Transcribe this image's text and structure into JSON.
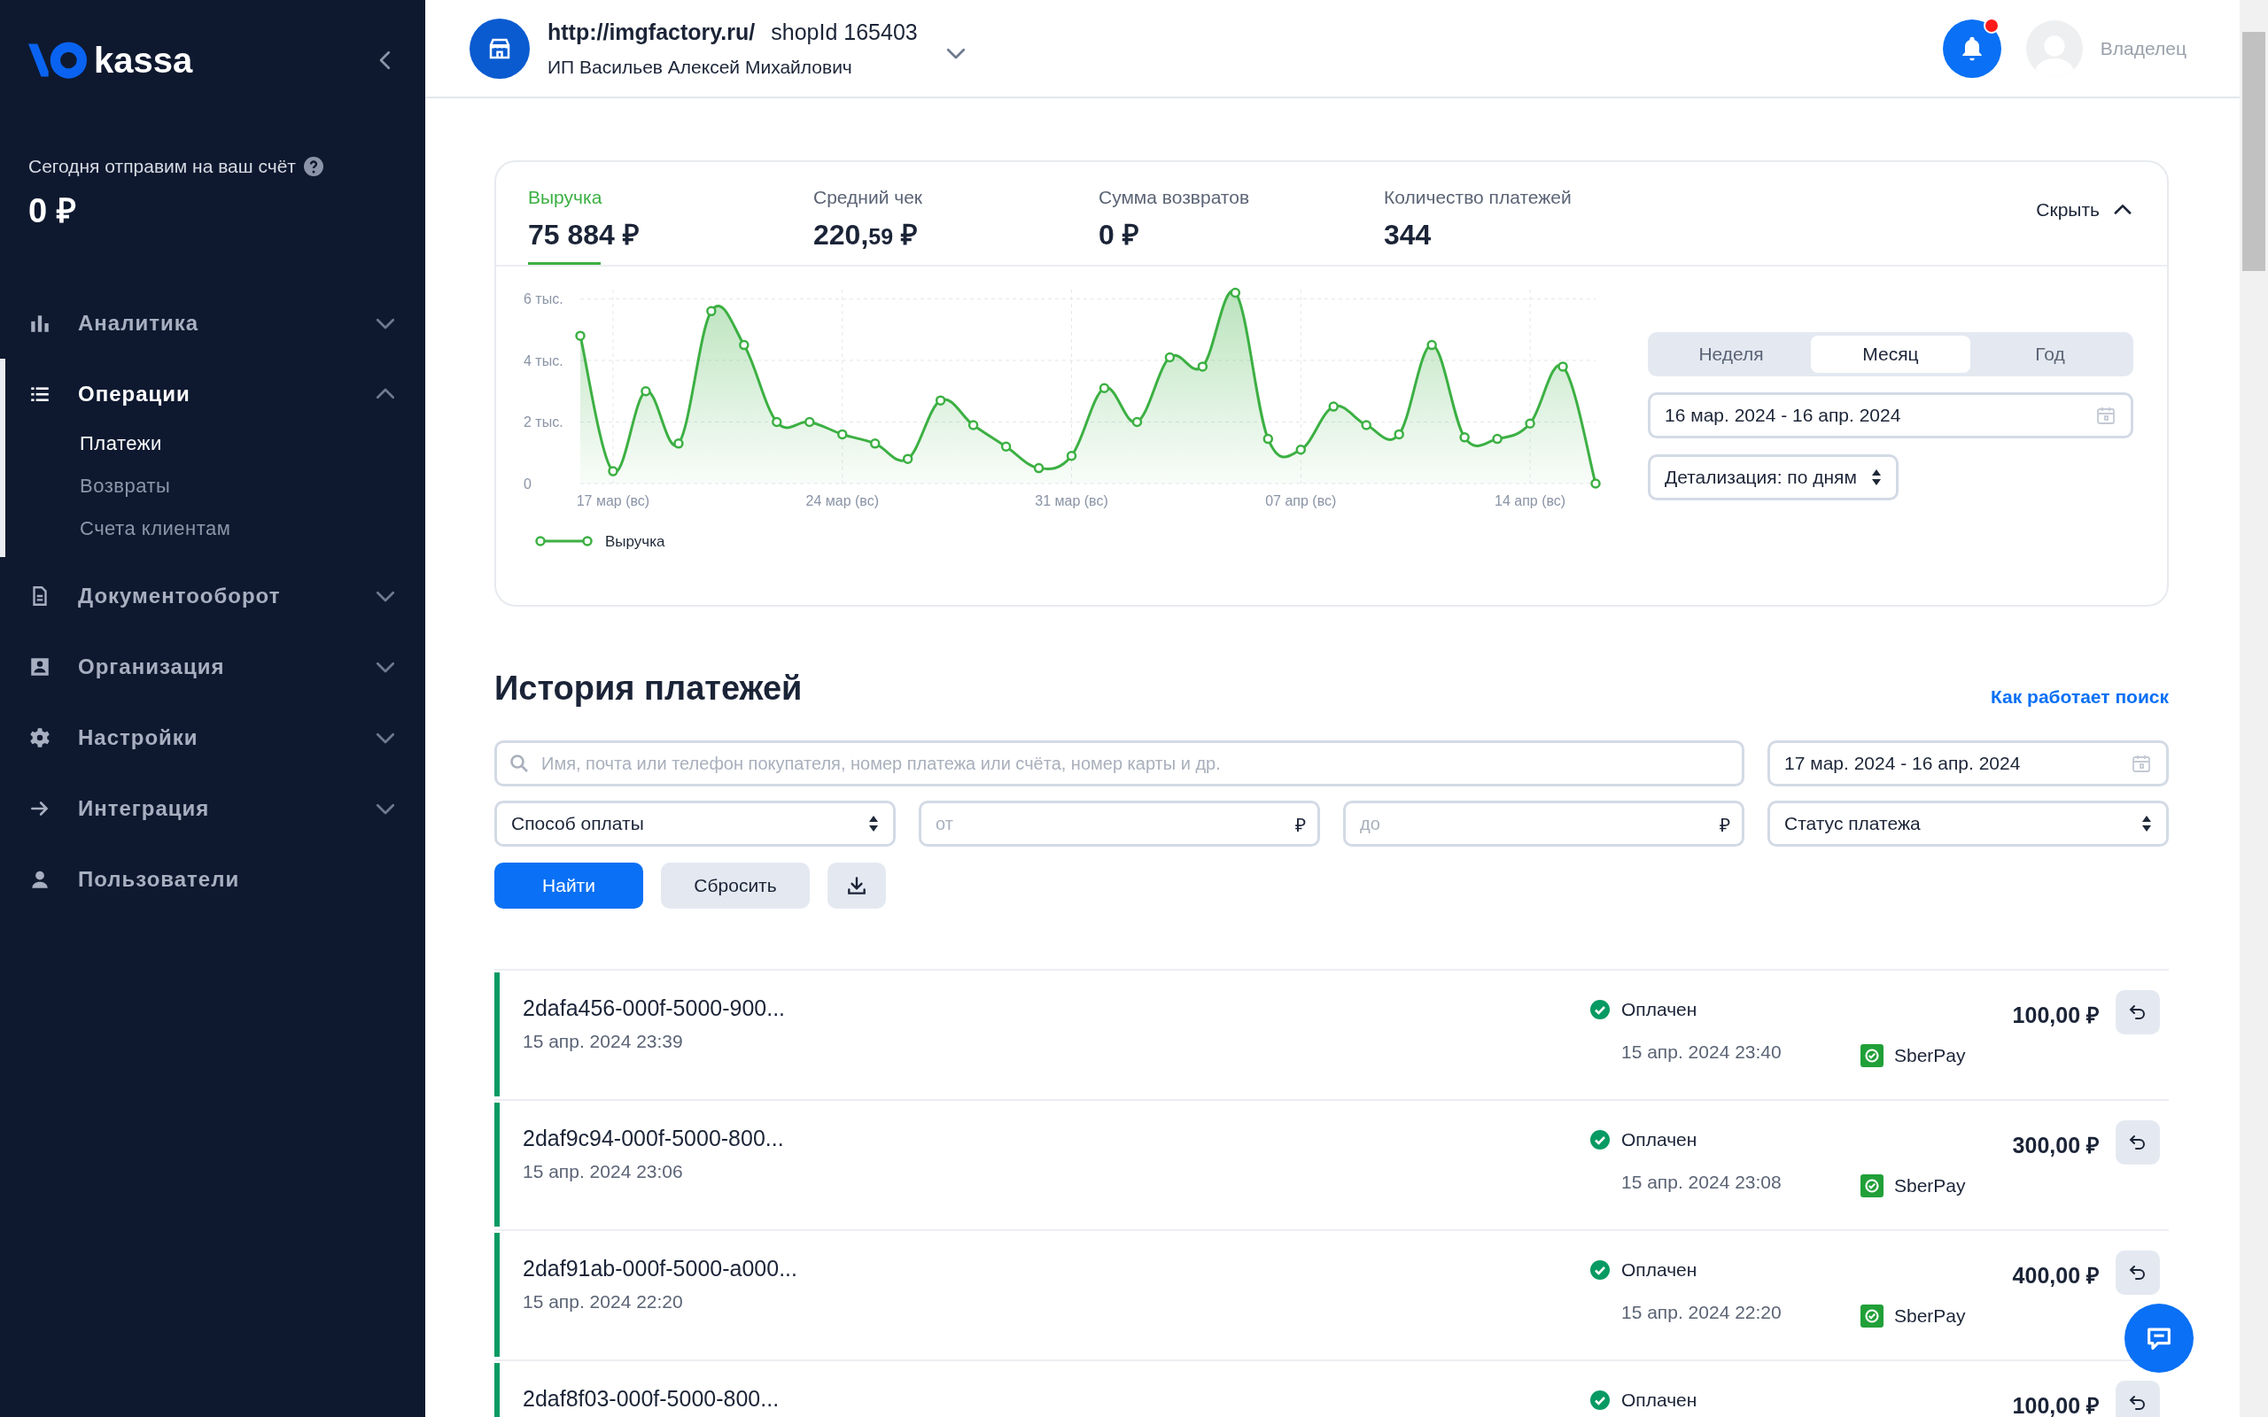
{
  "sidebar": {
    "logo_text": "kassa",
    "balance_label": "Сегодня отправим на ваш счёт",
    "balance_value": "0 ₽",
    "nav": [
      {
        "label": "Аналитика",
        "expanded": false,
        "selected": false
      },
      {
        "label": "Операции",
        "expanded": true,
        "selected": true,
        "children": [
          {
            "label": "Платежи",
            "selected": true
          },
          {
            "label": "Возвраты",
            "selected": false
          },
          {
            "label": "Счета клиентам",
            "selected": false
          }
        ]
      },
      {
        "label": "Документооборот",
        "expanded": false,
        "selected": false
      },
      {
        "label": "Организация",
        "expanded": false,
        "selected": false
      },
      {
        "label": "Настройки",
        "expanded": false,
        "selected": false
      },
      {
        "label": "Интеграция",
        "expanded": false,
        "selected": false
      },
      {
        "label": "Пользователи",
        "selected": false
      }
    ]
  },
  "header": {
    "shop_url": "http://imgfactory.ru/",
    "shop_id": "shopId 165403",
    "shop_owner": "ИП Васильев Алексей Михайлович",
    "notifications_unread": true,
    "user_role": "Владелец"
  },
  "stats": {
    "metrics": [
      {
        "label": "Выручка",
        "value": "75 884 ₽",
        "selected": true
      },
      {
        "label": "Средний чек",
        "value": "220,",
        "value_fraction": "59",
        "value_currency": " ₽",
        "selected": false
      },
      {
        "label": "Сумма возвратов",
        "value": "0 ₽",
        "selected": false
      },
      {
        "label": "Количество платежей",
        "value": "344",
        "selected": false
      }
    ],
    "hide_toggle": "Скрыть",
    "chart_data": {
      "type": "area",
      "grid": true,
      "categories": [
        null,
        "17 мар (вс)",
        null,
        null,
        null,
        null,
        null,
        null,
        "24 мар (вс)",
        null,
        null,
        null,
        null,
        null,
        null,
        "31 мар (вс)",
        null,
        null,
        null,
        null,
        null,
        null,
        "07 апр (вс)",
        null,
        null,
        null,
        null,
        null,
        null,
        "14 апр (вс)",
        null,
        null
      ],
      "series": [
        {
          "name": "Выручка",
          "color": "#3cb043",
          "marker": true,
          "values": [
            4.8,
            0.4,
            3.0,
            1.3,
            5.6,
            4.5,
            2.0,
            2.0,
            1.6,
            1.3,
            0.8,
            2.7,
            1.9,
            1.2,
            0.5,
            0.9,
            3.1,
            2.0,
            4.1,
            3.8,
            6.2,
            1.45,
            1.1,
            2.5,
            1.9,
            1.6,
            4.5,
            1.5,
            1.45,
            1.95,
            3.8,
            0
          ]
        }
      ],
      "ylim": [
        0,
        6.3
      ],
      "yticks": [
        {
          "value": 0,
          "label": "0"
        },
        {
          "value": 2,
          "label": "2 тыс."
        },
        {
          "value": 4,
          "label": "4 тыс."
        },
        {
          "value": 6,
          "label": "6 тыс."
        }
      ]
    },
    "periods": [
      {
        "label": "Неделя",
        "selected": false
      },
      {
        "label": "Месяц",
        "selected": true
      },
      {
        "label": "Год",
        "selected": false
      }
    ],
    "date_range": "16 мар. 2024 - 16 апр. 2024",
    "detail_select": "Детализация: по дням"
  },
  "history": {
    "title": "История платежей",
    "help_link": "Как работает поиск",
    "search_placeholder": "Имя, почта или телефон покупателя, номер платежа или счёта, номер карты и др.",
    "date_range": "17 мар. 2024 - 16 апр. 2024",
    "method_select": "Способ оплаты",
    "amount_from_placeholder": "от",
    "amount_to_placeholder": "до",
    "currency_sign": "₽",
    "status_select": "Статус платежа",
    "find_button": "Найти",
    "reset_button": "Сбросить",
    "rows": [
      {
        "id": "2dafa456-000f-5000-900...",
        "created": "15 апр. 2024 23:39",
        "status": "Оплачен",
        "status_time": "15 апр. 2024 23:40",
        "method": "SberPay",
        "amount": "100,00 ₽"
      },
      {
        "id": "2daf9c94-000f-5000-800...",
        "created": "15 апр. 2024 23:06",
        "status": "Оплачен",
        "status_time": "15 апр. 2024 23:08",
        "method": "SberPay",
        "amount": "300,00 ₽"
      },
      {
        "id": "2daf91ab-000f-5000-a000...",
        "created": "15 апр. 2024 22:20",
        "status": "Оплачен",
        "status_time": "15 апр. 2024 22:20",
        "method": "SberPay",
        "amount": "400,00 ₽"
      },
      {
        "id": "2daf8f03-000f-5000-800...",
        "status": "Оплачен",
        "amount": "100,00 ₽"
      }
    ]
  }
}
